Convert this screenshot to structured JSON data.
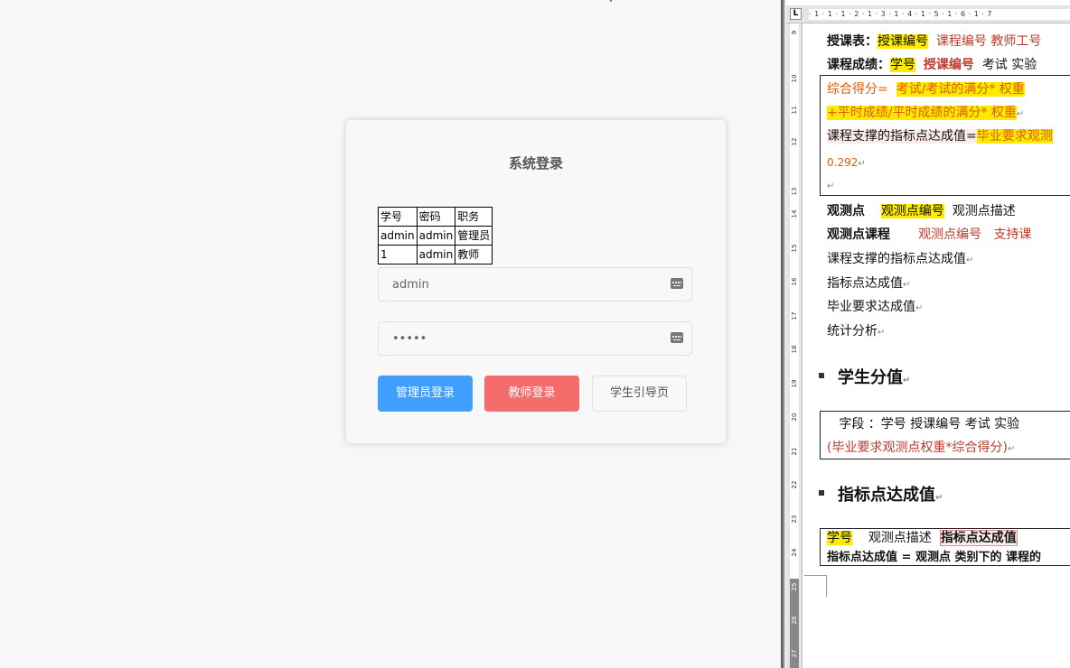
{
  "login": {
    "title": "系统登录",
    "hint_table": [
      [
        "学号",
        "密码",
        "职务"
      ],
      [
        "admin",
        "admin",
        "管理员"
      ],
      [
        "1",
        "admin",
        "教师"
      ]
    ],
    "username_value": "admin",
    "password_value": "admin",
    "admin_button": "管理员登录",
    "teacher_button": "教师登录",
    "guide_button": "学生引导页"
  },
  "word": {
    "ruler_corner": "L",
    "ruler_h": "· 1 · 1 · 1 · 2 · 1 · 3 · 1 · 4 · 1 · 5 · 1 · 6 · 1 · 7",
    "ruler_v_numbers": [
      "9",
      "10",
      "11",
      "12",
      "13",
      "14",
      "15",
      "16",
      "17",
      "18",
      "19",
      "20",
      "21",
      "22",
      "23",
      "24",
      "25",
      "26",
      "27"
    ],
    "line1_label": "授课表：",
    "line1_hl": "授课编号",
    "line1_rest": "课程编号 教师工号",
    "line2_label": "课程成绩：",
    "line2_hl1": "学号",
    "line2_hl2": "授课编号",
    "line2_rest": "考试 实验",
    "box_line1_a": "综合得分=",
    "box_line1_b": "考试/考试的满分* 权重",
    "box_line2": "+平时成绩/平时成绩的满分* 权重",
    "box_line3_a": "课程支撑的指标点达成值=",
    "box_line3_b": "毕业要求观测",
    "box_line4": "0.292",
    "line3_label": "观测点",
    "line3_hl": "观测点编号",
    "line3_rest": "观测点描述",
    "line4_label": "观测点课程",
    "line4_a": "观测点编号",
    "line4_b": "支持课",
    "line5": "课程支撑的指标点达成值",
    "line6": "指标点达成值",
    "line7": "毕业要求达成值",
    "line8": "统计分析",
    "heading1": "学生分值",
    "box2_line1": "字段 ：学号 授课编号 考试 实验",
    "box2_line2": "(毕业要求观测点权重*综合得分)",
    "heading2": "指标点达成值",
    "box3_hl": "学号",
    "box3_a": "观测点描述",
    "box3_b": "指标点达成值",
    "box3_line2": "指标点达成值 = 观测点 类别下的 课程的"
  }
}
